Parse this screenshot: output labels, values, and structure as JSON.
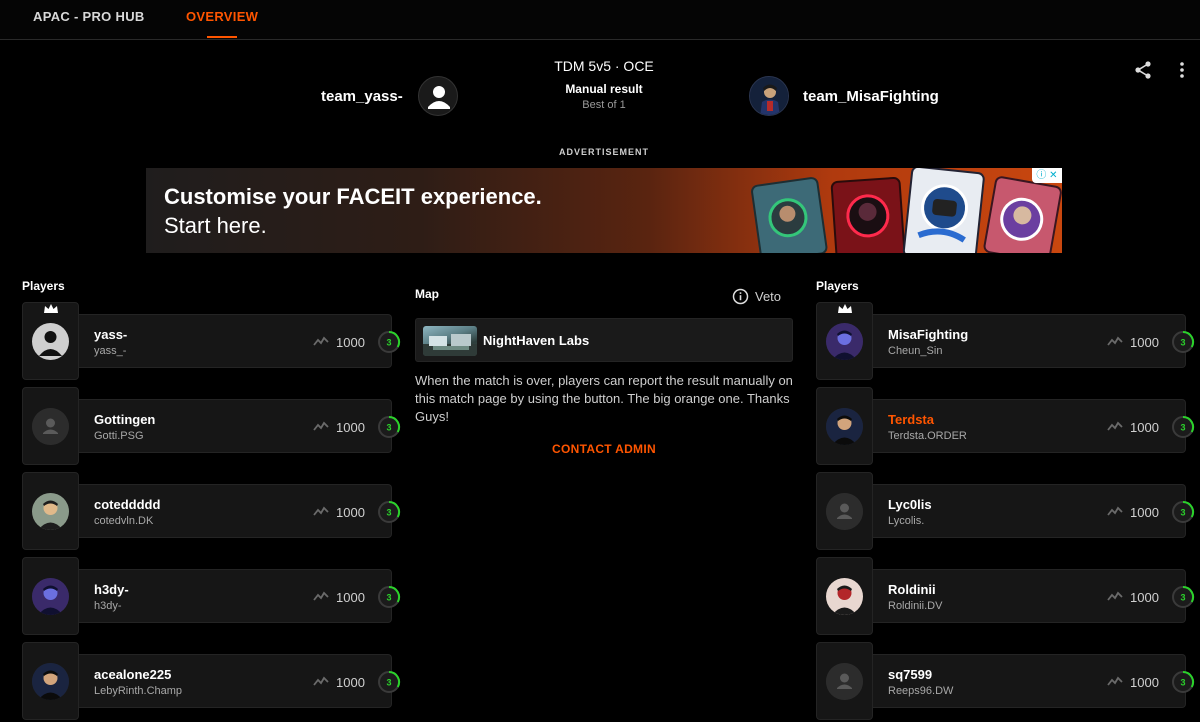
{
  "nav": {
    "tabs": [
      {
        "label": "APAC - PRO HUB"
      },
      {
        "label": "OVERVIEW"
      }
    ]
  },
  "match": {
    "title": "TDM 5v5 · OCE",
    "result": "Manual result",
    "best_of": "Best of 1",
    "team_left": "team_yass-",
    "team_right": "team_MisaFighting"
  },
  "ad": {
    "label": "ADVERTISEMENT",
    "line1": "Customise your FACEIT experience.",
    "line2": "Start here."
  },
  "left": {
    "title": "Players",
    "players": [
      {
        "name": "yass-",
        "sub": "yass_-",
        "elo": "1000",
        "level": "3",
        "avatar": "default-avatar",
        "leader": true
      },
      {
        "name": "Gottingen",
        "sub": "Gotti.PSG",
        "elo": "1000",
        "level": "3",
        "avatar": "placeholder-avatar"
      },
      {
        "name": "coteddddd",
        "sub": "cotedvln.DK",
        "elo": "1000",
        "level": "3",
        "avatar": "photo-avatar"
      },
      {
        "name": "h3dy-",
        "sub": "h3dy-",
        "elo": "1000",
        "level": "3",
        "avatar": "photo-avatar"
      },
      {
        "name": "acealone225",
        "sub": "LebyRinth.Champ",
        "elo": "1000",
        "level": "3",
        "avatar": "photo-avatar"
      }
    ]
  },
  "right": {
    "title": "Players",
    "players": [
      {
        "name": "MisaFighting",
        "sub": "Cheun_Sin",
        "elo": "1000",
        "level": "3",
        "avatar": "photo-avatar",
        "leader": true
      },
      {
        "name": "Terdsta",
        "sub": "Terdsta.ORDER",
        "elo": "1000",
        "level": "3",
        "avatar": "photo-avatar",
        "highlight": true
      },
      {
        "name": "Lyc0lis",
        "sub": "Lycolis.",
        "elo": "1000",
        "level": "3",
        "avatar": "placeholder-avatar"
      },
      {
        "name": "Roldinii",
        "sub": "Roldinii.DV",
        "elo": "1000",
        "level": "3",
        "avatar": "photo-avatar"
      },
      {
        "name": "sq7599",
        "sub": "Reeps96.DW",
        "elo": "1000",
        "level": "3",
        "avatar": "placeholder-avatar"
      }
    ]
  },
  "map": {
    "title": "Map",
    "name": "NightHaven Labs",
    "veto_label": "Veto",
    "info": "When the match is over, players can report the result manually on this match page by using the button. The big orange one. Thanks Guys!",
    "contact_admin": "CONTACT ADMIN"
  },
  "colors": {
    "accent": "#ff5500",
    "level_ring": "#2bd32b",
    "background": "#000000",
    "card": "#161616"
  },
  "icons": {
    "share": "share-icon",
    "more": "more-vertical-icon",
    "info": "info-icon",
    "trend": "trend-icon",
    "crown": "crown-icon",
    "level": "skill-level-icon"
  }
}
